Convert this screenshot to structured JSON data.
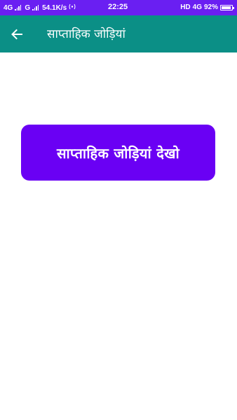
{
  "status_bar": {
    "network_left": "4G",
    "network_second": "G",
    "speed": "54.1K/s",
    "time": "22:25",
    "hd": "HD",
    "network_right": "4G",
    "battery": "92%",
    "battery_level": 0.92,
    "color": "#6a1ff2"
  },
  "app_bar": {
    "title": "साप्ताहिक जोड़ियां",
    "back_icon": "arrow-left-icon",
    "color": "#0b8f86"
  },
  "main": {
    "button_label": "साप्ताहिक जोड़ियां देखो",
    "button_color": "#6a00f4"
  }
}
